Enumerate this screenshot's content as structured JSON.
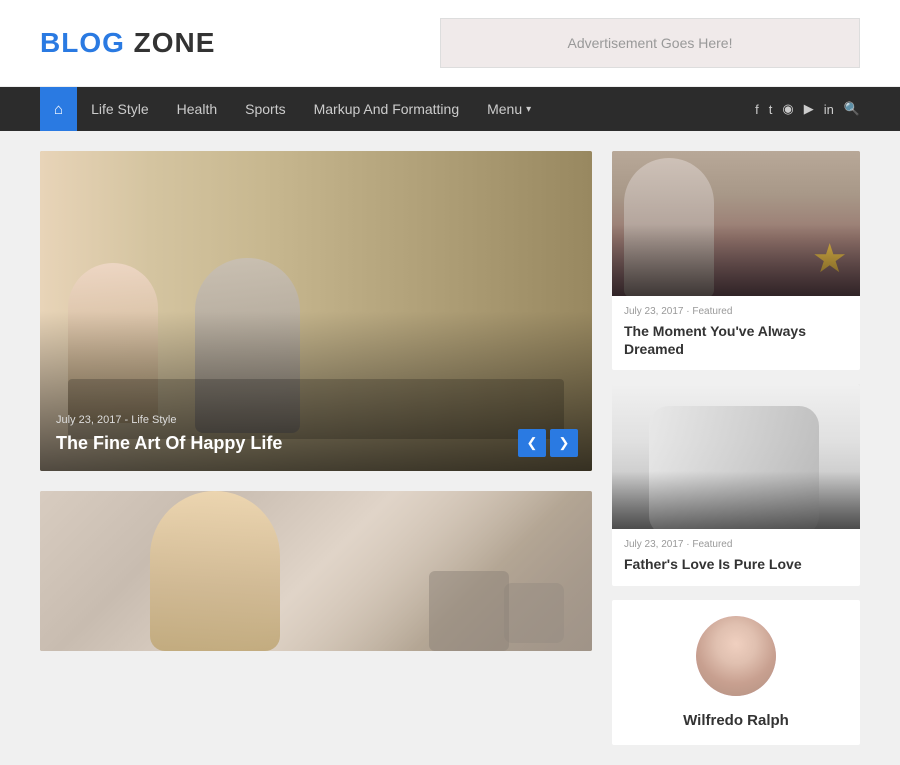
{
  "header": {
    "logo_blue": "BLOG",
    "logo_dark": " ZONE",
    "ad_text": "Advertisement Goes Here!"
  },
  "navbar": {
    "home_icon": "⌂",
    "items": [
      "Life Style",
      "Health",
      "Sports",
      "Markup And Formatting"
    ],
    "menu_label": "Menu",
    "social_icons": [
      "f",
      "t",
      "◉",
      "▶",
      "in",
      "🔍"
    ]
  },
  "featured": {
    "meta": "July 23, 2017 - Life Style",
    "title": "The Fine Art Of Happy Life",
    "prev_label": "❮",
    "next_label": "❯"
  },
  "right_cards": [
    {
      "meta": "July 23, 2017 · Featured",
      "title": "The Moment You've Always Dreamed"
    },
    {
      "meta": "July 23, 2017 · Featured",
      "title": "Father's Love Is Pure Love"
    }
  ],
  "author": {
    "name": "Wilfredo Ralph"
  },
  "bottom_left": {
    "alt": "Bottom story image"
  }
}
